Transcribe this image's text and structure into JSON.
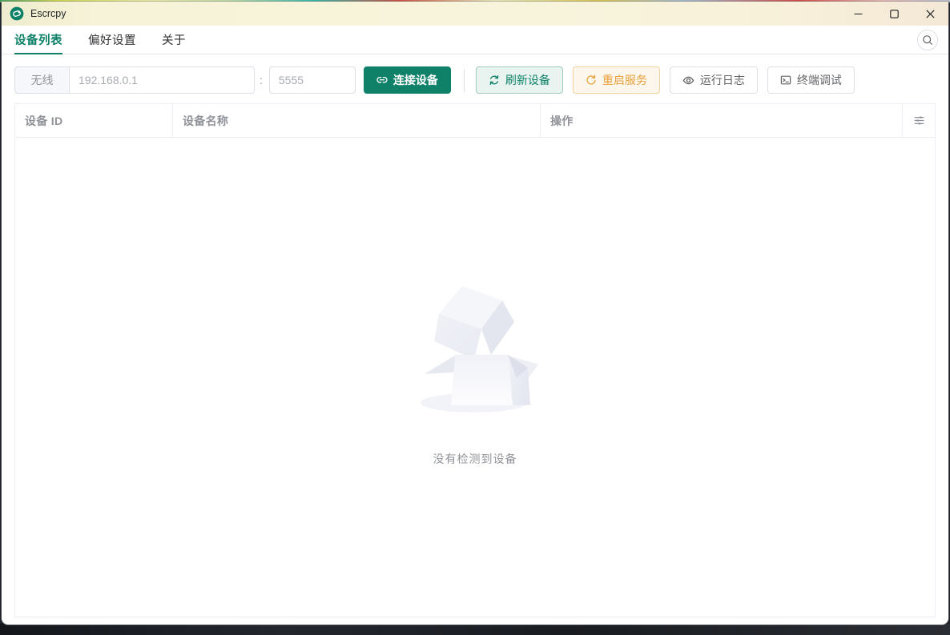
{
  "window": {
    "title": "Escrcpy",
    "controls": {
      "minimize": "minimize",
      "maximize": "maximize",
      "close": "close"
    }
  },
  "tabs": [
    {
      "label": "设备列表",
      "active": true
    },
    {
      "label": "偏好设置",
      "active": false
    },
    {
      "label": "关于",
      "active": false
    }
  ],
  "toolbar": {
    "wireless_label": "无线",
    "ip_placeholder": "192.168.0.1",
    "port_separator": ":",
    "port_placeholder": "5555",
    "connect_button": "连接设备",
    "refresh_button": "刷新设备",
    "restart_button": "重启服务",
    "logs_button": "运行日志",
    "terminal_button": "终端调试"
  },
  "device_table": {
    "columns": [
      "设备 ID",
      "设备名称",
      "操作"
    ],
    "rows": [],
    "empty_text": "没有检测到设备"
  },
  "icons": {
    "logo": "escrcpy-logo",
    "search": "magnifier",
    "connect": "link",
    "refresh": "circular-arrows",
    "restart": "refresh-right-arrow",
    "logs": "eye",
    "terminal": "terminal-window",
    "column_settings": "sliders",
    "minimize": "–",
    "maximize": "□",
    "close": "×"
  },
  "colors": {
    "primary": "#0e8168",
    "primary_light_bg": "#e9f4f0",
    "primary_light_border": "#9fccbe",
    "warning": "#e6a23c",
    "warning_light_bg": "#fdf6ec",
    "warning_light_border": "#f3d19e",
    "titlebar_bg": "#f8f4dc",
    "muted_text": "#909399",
    "border": "#dcdfe6",
    "table_border": "#ebeef5"
  }
}
